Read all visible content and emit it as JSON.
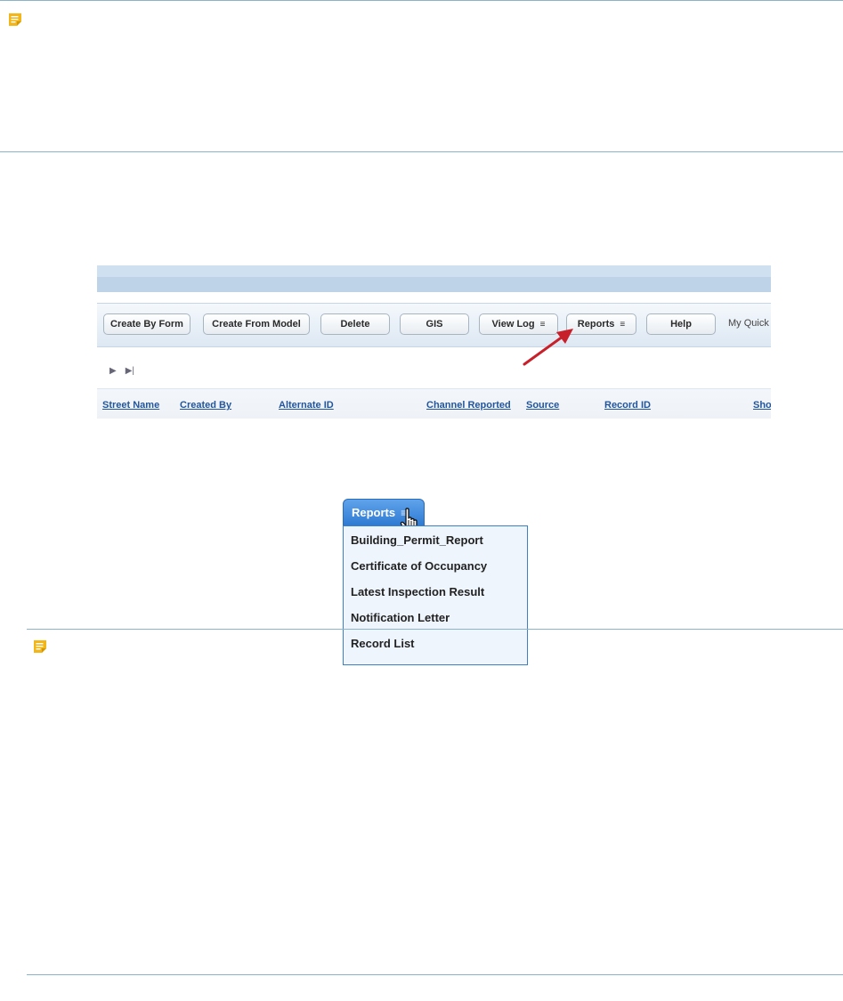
{
  "toolbar": {
    "buttons": [
      {
        "label": "Create By Form"
      },
      {
        "label": "Create From Model"
      },
      {
        "label": "Delete"
      },
      {
        "label": "GIS"
      },
      {
        "label": "View Log",
        "caret": "≡"
      },
      {
        "label": "Reports",
        "caret": "≡"
      },
      {
        "label": "Help"
      }
    ],
    "quick_label": "My Quick"
  },
  "pager": {
    "next_glyph": "▶",
    "last_glyph": "▶|"
  },
  "columns": [
    "Street Name",
    "Created By",
    "Alternate ID",
    "Channel Reported",
    "Source",
    "Record ID",
    "Sho"
  ],
  "dropdown": {
    "label": "Reports",
    "caret": "≡",
    "items": [
      "Building_Permit_Report",
      "Certificate of Occupancy",
      "Latest Inspection Result",
      "Notification Letter",
      "Record List"
    ]
  },
  "icons": {
    "note": "note-icon",
    "hand": "hand-cursor-icon",
    "arrow": "red-arrow-icon"
  },
  "colors": {
    "accent": "#2f7bd3",
    "link": "#23559a",
    "arrow": "#c8202a",
    "note": "#f2b619"
  }
}
